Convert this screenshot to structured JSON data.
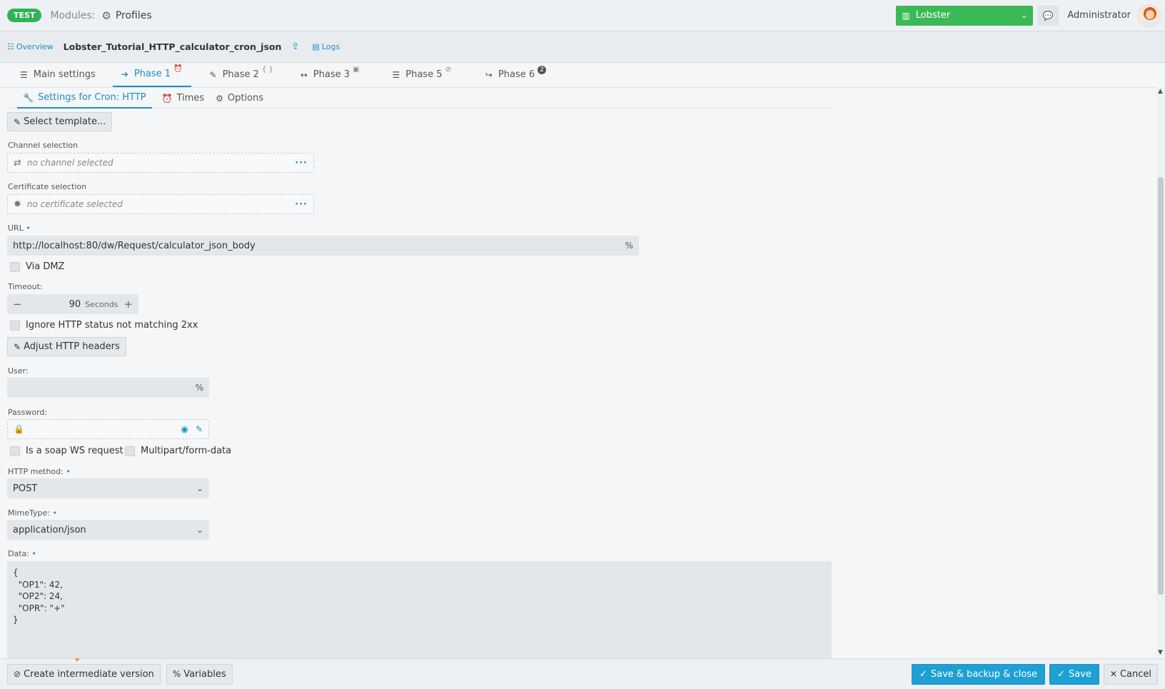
{
  "topbar": {
    "env_badge": "TEST",
    "modules_label": "Modules:",
    "modules_icon": "cpu-icon",
    "profiles_label": "Profiles",
    "environment": "Lobster",
    "user_name": "Administrator",
    "accent_color": "#1a8fc3",
    "env_color": "#3cb957"
  },
  "subbar": {
    "overview": "Overview",
    "profile_name": "Lobster_Tutorial_HTTP_calculator_cron_json",
    "logs": "Logs"
  },
  "tabs": [
    {
      "label": "Main settings",
      "icon": "list-icon",
      "suffix": ""
    },
    {
      "label": "Phase 1",
      "icon": "sign-in-icon",
      "suffix": "⏰"
    },
    {
      "label": "Phase 2",
      "icon": "file-edit-icon",
      "suffix": "{ }"
    },
    {
      "label": "Phase 3",
      "icon": "arrows-horizontal-icon",
      "suffix": "▣"
    },
    {
      "label": "Phase 5",
      "icon": "server-icon",
      "suffix": "⃠"
    },
    {
      "label": "Phase 6",
      "icon": "share-icon",
      "suffix": "2"
    }
  ],
  "subtabs": [
    {
      "label": "Settings for Cron: HTTP",
      "icon": "wrench-icon"
    },
    {
      "label": "Times",
      "icon": "alarm-clock-icon"
    },
    {
      "label": "Options",
      "icon": "cogs-icon"
    }
  ],
  "form": {
    "select_template": "Select template...",
    "channel_label": "Channel selection",
    "channel_placeholder": "no channel selected",
    "certificate_label": "Certificate selection",
    "certificate_placeholder": "no certificate selected",
    "url_label": "URL",
    "url_value": "http://localhost:80/dw/Request/calculator_json_body",
    "via_dmz": "Via DMZ",
    "timeout_label": "Timeout:",
    "timeout_value": "90",
    "timeout_unit": "Seconds",
    "ignore_status": "Ignore HTTP status not matching 2xx",
    "adjust_headers": "Adjust HTTP headers",
    "user_label": "User:",
    "user_value": "",
    "password_label": "Password:",
    "soap_label": "Is a soap WS request",
    "multipart_label": "Multipart/form-data",
    "method_label": "HTTP method:",
    "method_value": "POST",
    "mime_label": "MimeType:",
    "mime_value": "application/json",
    "data_label": "Data:",
    "data_value": "{\n  \"OP1\": 42,\n  \"OP2\": 24,\n  \"OPR\": \"+\"\n}",
    "required_mark": "•"
  },
  "bottombar": {
    "intermediate": "Create intermediate version",
    "variables": "Variables",
    "save_backup_close": "Save & backup & close",
    "save": "Save",
    "cancel": "Cancel"
  }
}
